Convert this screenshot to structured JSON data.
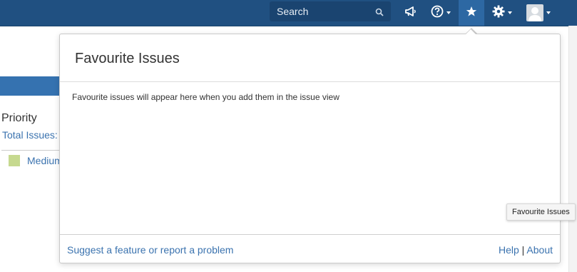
{
  "header": {
    "search_placeholder": "Search",
    "icons": [
      "search-icon",
      "megaphone-icon",
      "help-icon",
      "star-icon",
      "gear-icon",
      "user-avatar-icon"
    ]
  },
  "background_page": {
    "priority_label": "Priority",
    "total_issues_label": "Total Issues:",
    "medium_label": "Medium"
  },
  "dialog": {
    "title": "Favourite Issues",
    "empty_message": "Favourite issues will appear here when you add them in the issue view",
    "footer": {
      "feedback_link": "Suggest a feature or report a problem",
      "help_link": "Help",
      "separator": "|",
      "about_link": "About"
    }
  },
  "tooltip": {
    "text": "Favourite Issues"
  },
  "colors": {
    "header_bg": "#205081",
    "link": "#3b73af",
    "accent": "#3572b0",
    "medium_swatch": "#c6d98f"
  }
}
